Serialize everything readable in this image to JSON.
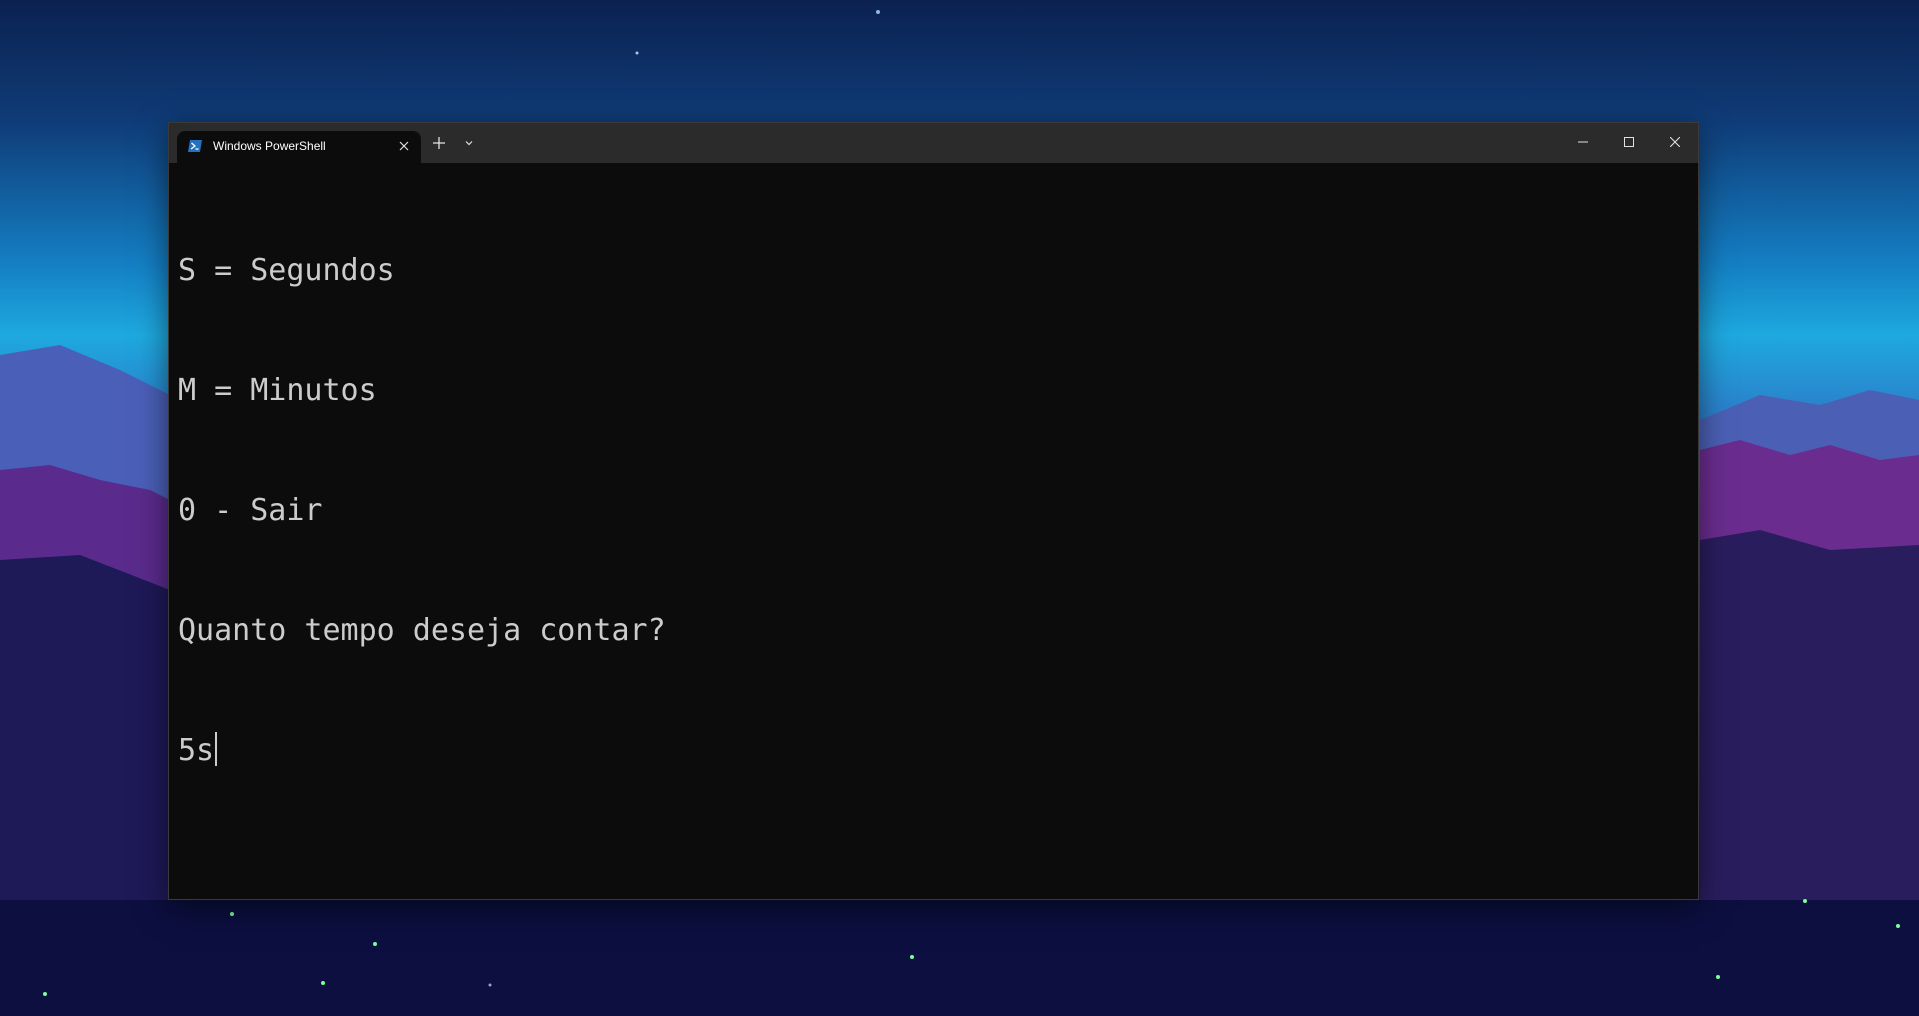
{
  "window": {
    "tab_title": "Windows PowerShell",
    "tab_icon": "powershell-icon",
    "new_tab_icon": "plus-icon",
    "dropdown_icon": "chevron-down-icon",
    "controls": [
      "minimize-icon",
      "maximize-icon",
      "close-icon"
    ]
  },
  "terminal": {
    "lines": [
      "S = Segundos",
      "M = Minutos",
      "0 - Sair",
      "Quanto tempo deseja contar?"
    ],
    "input": "5s",
    "background": "#0c0c0c",
    "foreground": "#cccccc"
  },
  "colors": {
    "titlebar": "#2b2b2b",
    "tab_active": "#0c0c0c",
    "powershell_blue": "#2671be"
  }
}
